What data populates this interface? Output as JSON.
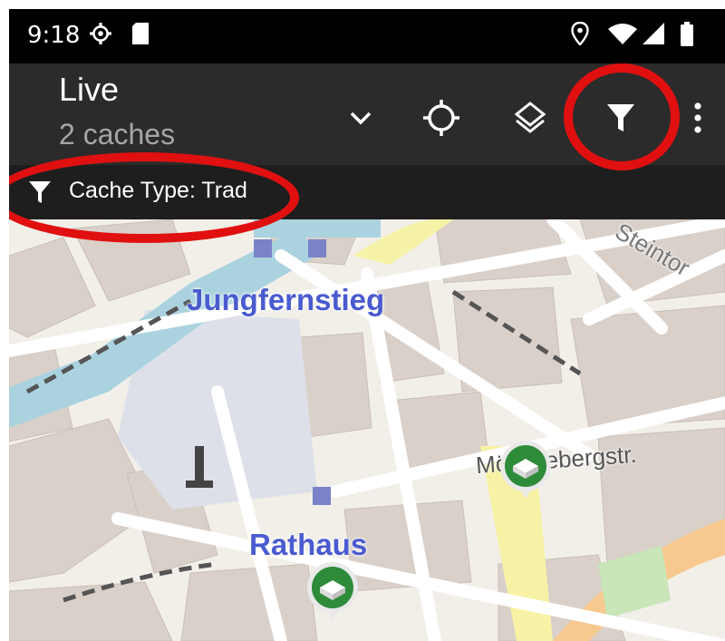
{
  "status_bar": {
    "time": "9:18",
    "icons": [
      "settings-icon",
      "sd-card-icon",
      "location-icon",
      "wifi-icon",
      "signal-icon",
      "battery-icon"
    ]
  },
  "toolbar": {
    "title": "Live",
    "subtitle": "2 caches",
    "actions": [
      "chevron-down-icon",
      "my-location-icon",
      "layers-icon",
      "filter-icon",
      "overflow-menu-icon"
    ]
  },
  "filter_bar": {
    "label": "Cache Type: Trad"
  },
  "map": {
    "labels": {
      "jungfernstieg": "Jungfernstieg",
      "rathaus": "Rathaus",
      "moenckebergstr": "Mönckebergstr.",
      "steintor": "Steintor"
    },
    "markers": [
      "traditional-cache",
      "traditional-cache"
    ]
  },
  "colors": {
    "toolbar_bg": "#2b2b2b",
    "filter_bar_bg": "#1e1e1e",
    "highlight_ring": "#e01010",
    "cache_marker": "#2e8b3a",
    "water": "#aad3df",
    "map_label": "#4a5bd0"
  }
}
